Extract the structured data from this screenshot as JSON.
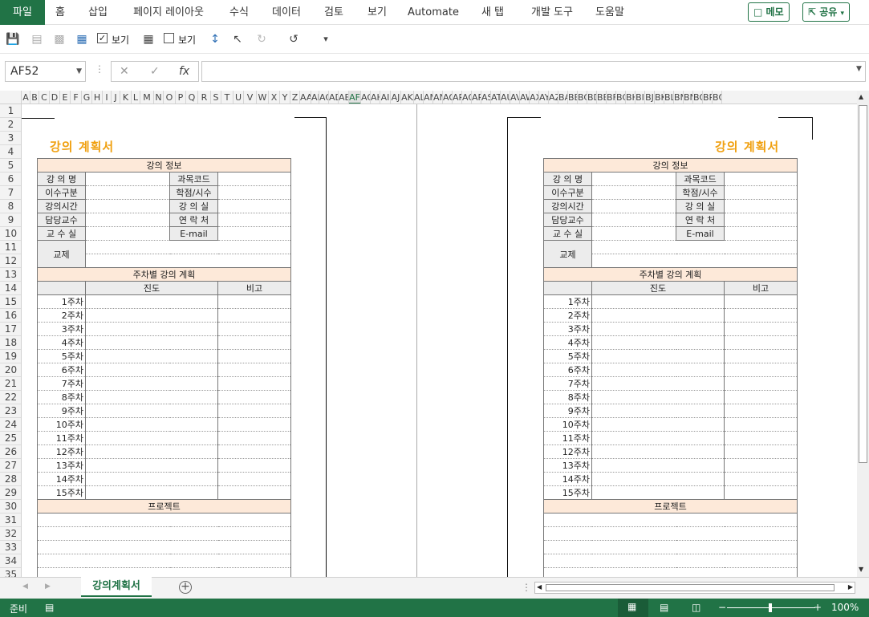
{
  "ribbon": {
    "tabs": [
      "파일",
      "홈",
      "삽입",
      "페이지 레이아웃",
      "수식",
      "데이터",
      "검토",
      "보기",
      "Automate",
      "새 탭",
      "개발 도구",
      "도움말"
    ],
    "memo_label": "메모",
    "share_label": "공유"
  },
  "qat": {
    "view_label_1": "보기",
    "view_label_2": "보기"
  },
  "formula_bar": {
    "name_box": "AF52",
    "formula": ""
  },
  "columns": [
    "A",
    "B",
    "C",
    "D",
    "E",
    "F",
    "G",
    "H",
    "I",
    "J",
    "K",
    "L",
    "M",
    "N",
    "O",
    "P",
    "Q",
    "R",
    "S",
    "T",
    "U",
    "V",
    "W",
    "X",
    "Y",
    "Z",
    "AA",
    "AB",
    "AC",
    "AD",
    "AE",
    "AF",
    "AG",
    "AH",
    "AI",
    "AJ",
    "AK",
    "AL",
    "AM",
    "AN",
    "AO",
    "AP",
    "AQ",
    "AR",
    "AS",
    "AT",
    "AU",
    "AV",
    "AW",
    "AX",
    "AY",
    "AZ",
    "BA",
    "BB",
    "BC",
    "BD",
    "BE",
    "BF",
    "BG",
    "BH",
    "BI",
    "BJ",
    "BK",
    "BL",
    "BM",
    "BN",
    "BO",
    "BP",
    "BQ"
  ],
  "selected_column": "AF",
  "rows": [
    "1",
    "2",
    "3",
    "4",
    "5",
    "6",
    "7",
    "8",
    "9",
    "10",
    "11",
    "12",
    "13",
    "14",
    "15",
    "16",
    "17",
    "18",
    "19",
    "20",
    "21",
    "22",
    "23",
    "24",
    "25",
    "26",
    "27",
    "28",
    "29",
    "30",
    "31",
    "32",
    "33",
    "34",
    "35"
  ],
  "document": {
    "title": "강의 계획서",
    "section_info": "강의 정보",
    "labels_left": [
      "강 의 명",
      "이수구분",
      "강의시간",
      "담당교수",
      "교 수 실"
    ],
    "labels_right": [
      "과목코드",
      "학점/시수",
      "강 의 실",
      "연 락 처",
      "E-mail"
    ],
    "textbook": "교제",
    "section_weekly": "주차별 강의 계획",
    "col_progress": "진도",
    "col_note": "비고",
    "weeks": [
      "1주차",
      "2주차",
      "3주차",
      "4주차",
      "5주차",
      "6주차",
      "7주차",
      "8주차",
      "9주차",
      "10주차",
      "11주차",
      "12주차",
      "13주차",
      "14주차",
      "15주차"
    ],
    "section_project": "프로젝트"
  },
  "sheet_tab": "강의계획서",
  "status": {
    "ready": "준비",
    "zoom": "100%"
  }
}
